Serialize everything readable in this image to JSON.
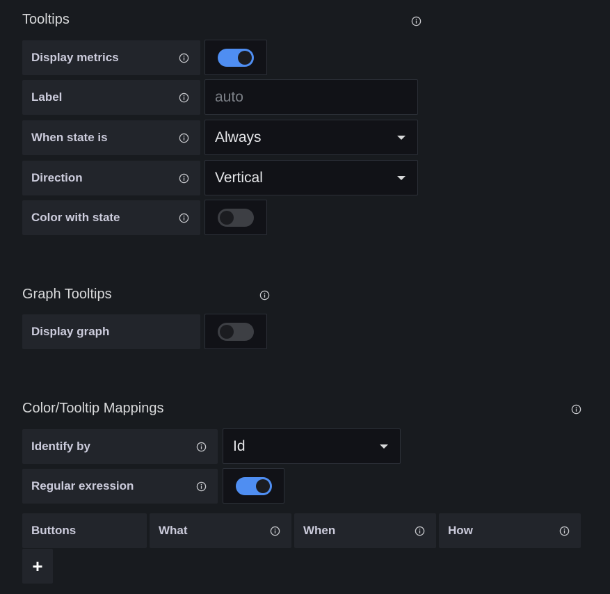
{
  "tooltips": {
    "title": "Tooltips",
    "rows": {
      "display_metrics": {
        "label": "Display metrics",
        "enabled": true
      },
      "label": {
        "label": "Label",
        "placeholder": "auto",
        "value": ""
      },
      "when_state_is": {
        "label": "When state is",
        "value": "Always"
      },
      "direction": {
        "label": "Direction",
        "value": "Vertical"
      },
      "color_with_state": {
        "label": "Color with state",
        "enabled": false
      }
    }
  },
  "graph_tooltips": {
    "title": "Graph Tooltips",
    "rows": {
      "display_graph": {
        "label": "Display graph",
        "enabled": false
      }
    }
  },
  "mappings": {
    "title": "Color/Tooltip Mappings",
    "rows": {
      "identify_by": {
        "label": "Identify by",
        "value": "Id"
      },
      "regular_expression": {
        "label": "Regular exression",
        "enabled": true
      }
    },
    "columns": [
      "Buttons",
      "What",
      "When",
      "How"
    ],
    "add_button": "+"
  },
  "colors": {
    "background": "#181b1f",
    "label_bg": "#22252b",
    "control_bg": "#111217",
    "switch_on": "#4f8ef2",
    "switch_off": "#3d3f44"
  },
  "icons": {
    "info": "info-circle-icon",
    "caret": "caret-down-icon",
    "add": "plus-icon"
  }
}
